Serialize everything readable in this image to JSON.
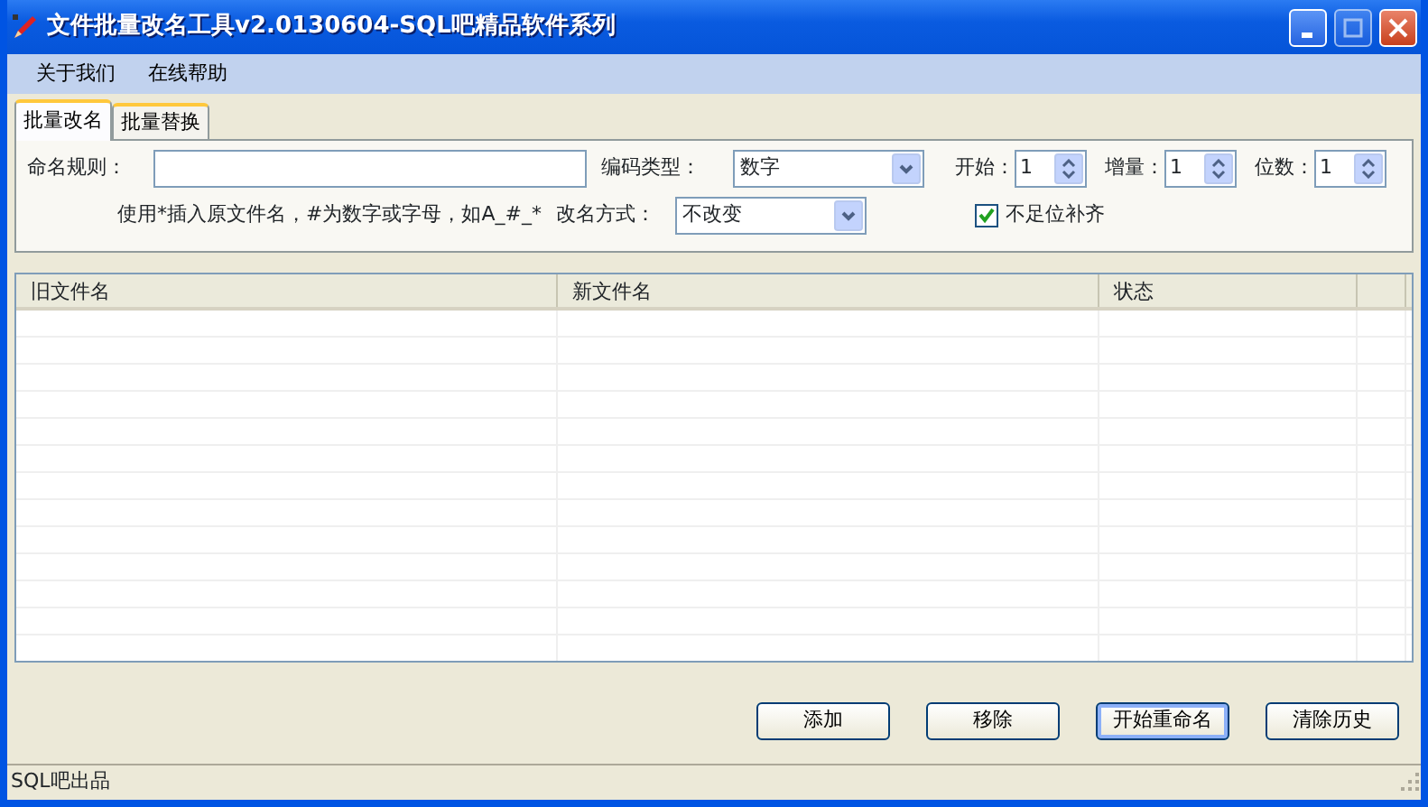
{
  "window": {
    "title": "文件批量改名工具v2.0130604-SQL吧精品软件系列"
  },
  "menu": [
    "关于我们",
    "在线帮助"
  ],
  "tabs": [
    {
      "label": "批量改名",
      "selected": true
    },
    {
      "label": "批量替换",
      "selected": false
    }
  ],
  "form": {
    "naming_rule_label": "命名规则：",
    "hint": "使用*插入原文件名，#为数字或字母，如A_#_*",
    "encoding_label": "编码类型：",
    "encoding_value": "数字",
    "rename_mode_label": "改名方式：",
    "rename_mode_value": "不改变",
    "spinners": [
      {
        "label": "开始：",
        "value": "1"
      },
      {
        "label": "增量：",
        "value": "1"
      },
      {
        "label": "位数：",
        "value": "1"
      }
    ],
    "pad_checkbox": {
      "label": "不足位补齐",
      "checked": true
    }
  },
  "table": {
    "columns": [
      "旧文件名",
      "新文件名",
      "状态"
    ]
  },
  "buttons": [
    {
      "label": "添加",
      "focused": false
    },
    {
      "label": "移除",
      "focused": false
    },
    {
      "label": "开始重命名",
      "focused": true
    },
    {
      "label": "清除历史",
      "focused": false
    }
  ],
  "status_bar": "SQL吧出品"
}
